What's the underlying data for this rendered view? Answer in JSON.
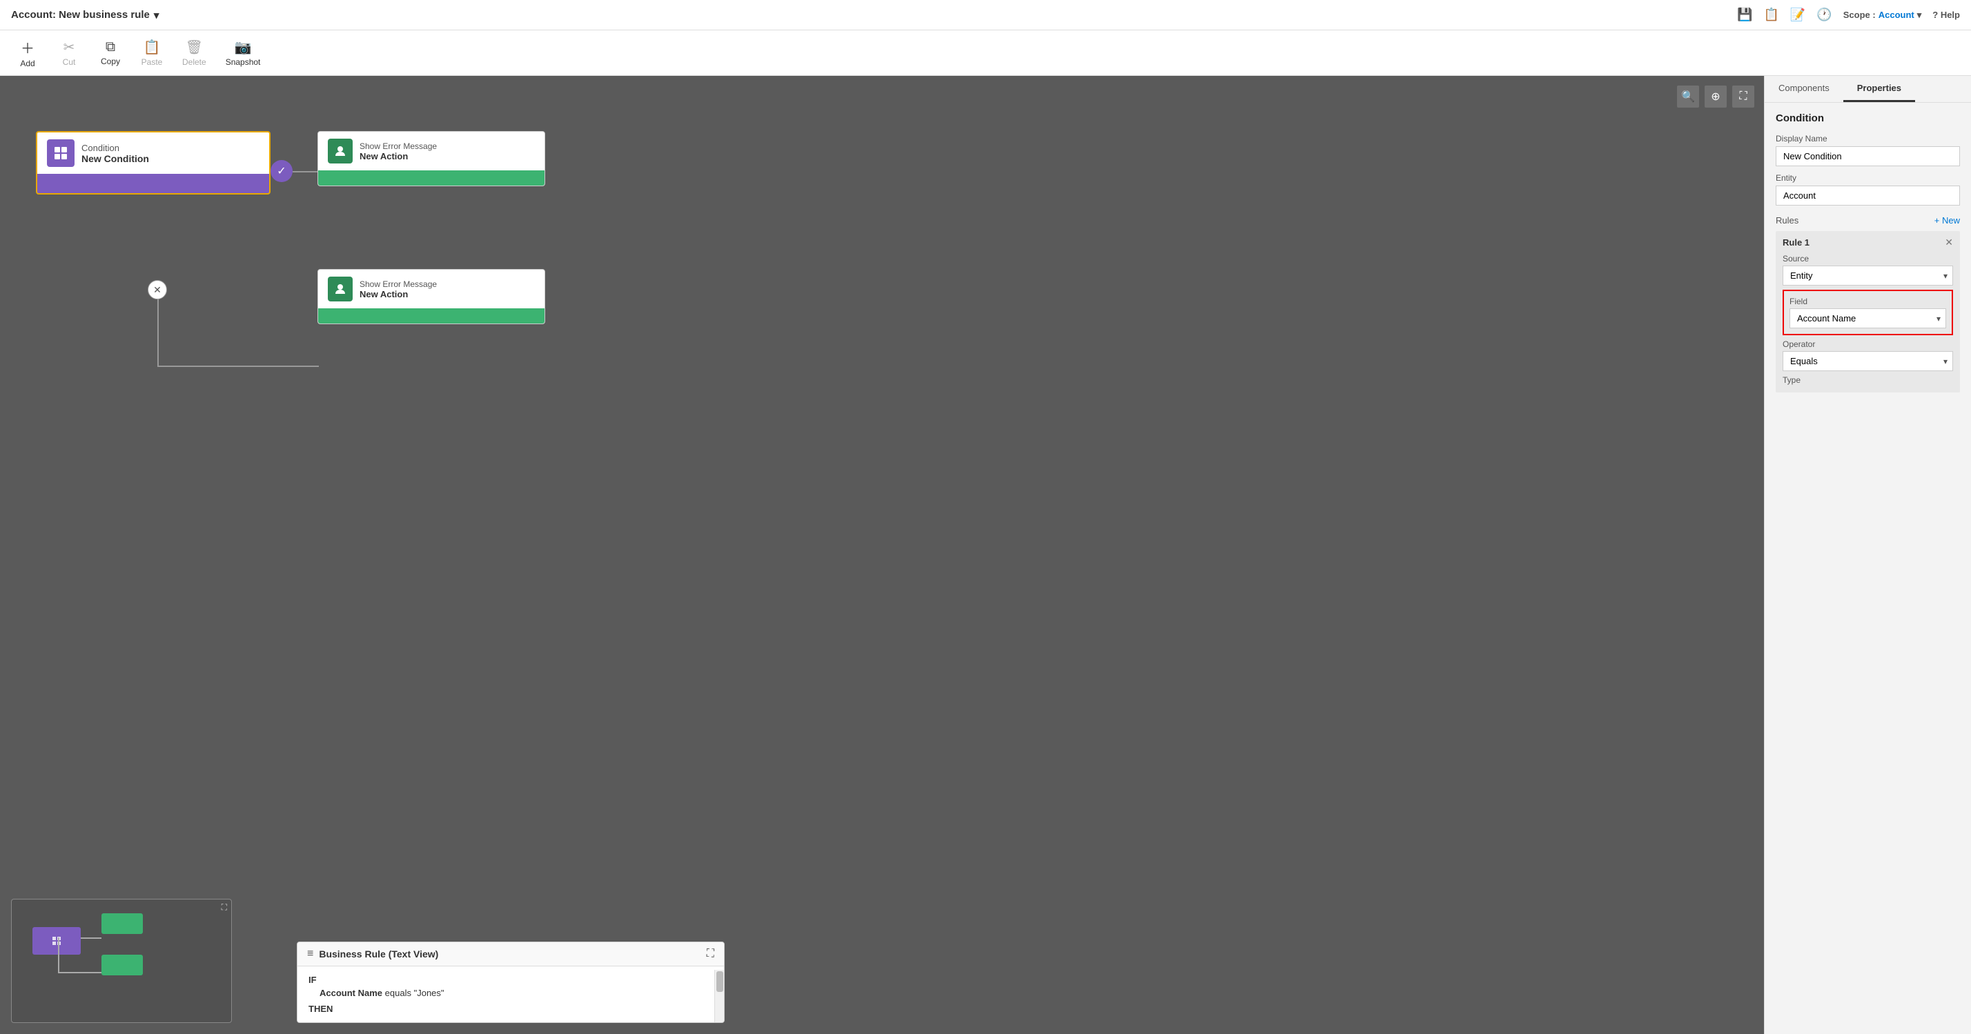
{
  "titleBar": {
    "title": "Account: New business rule",
    "chevron": "▾",
    "icons": [
      "💾",
      "📋",
      "📝",
      "🕐"
    ],
    "scopeLabel": "Scope :",
    "scopeValue": "Account",
    "helpLabel": "? Help"
  },
  "toolbar": {
    "addLabel": "Add",
    "cutLabel": "Cut",
    "copyLabel": "Copy",
    "pasteLabel": "Paste",
    "deleteLabel": "Delete",
    "snapshotLabel": "Snapshot"
  },
  "canvas": {
    "zoomOutIcon": "🔍",
    "zoomInIcon": "⊕",
    "fitIcon": "⛶",
    "condition": {
      "typeLabel": "Condition",
      "name": "New Condition",
      "icon": "⊞"
    },
    "action1": {
      "typeLabel": "Show Error Message",
      "name": "New Action",
      "icon": "👤"
    },
    "action2": {
      "typeLabel": "Show Error Message",
      "name": "New Action",
      "icon": "👤"
    }
  },
  "textView": {
    "title": "Business Rule (Text View)",
    "icon": "≡",
    "ifLabel": "IF",
    "conditionText": "Account Name",
    "conditionOp": "equals",
    "conditionVal": "\"Jones\"",
    "thenLabel": "THEN"
  },
  "rightPanel": {
    "tabs": [
      "Components",
      "Properties"
    ],
    "activeTab": "Properties",
    "sectionTitle": "Condition",
    "displayNameLabel": "Display Name",
    "displayNameValue": "New Condition",
    "entityLabel": "Entity",
    "entityValue": "Account",
    "rulesLabel": "Rules",
    "addNewLabel": "+ New",
    "rule": {
      "title": "Rule 1",
      "sourceLabel": "Source",
      "sourceValue": "Entity",
      "fieldLabel": "Field",
      "fieldValue": "Account Name",
      "operatorLabel": "Operator",
      "operatorValue": "Equals",
      "typeLabel": "Type"
    }
  }
}
